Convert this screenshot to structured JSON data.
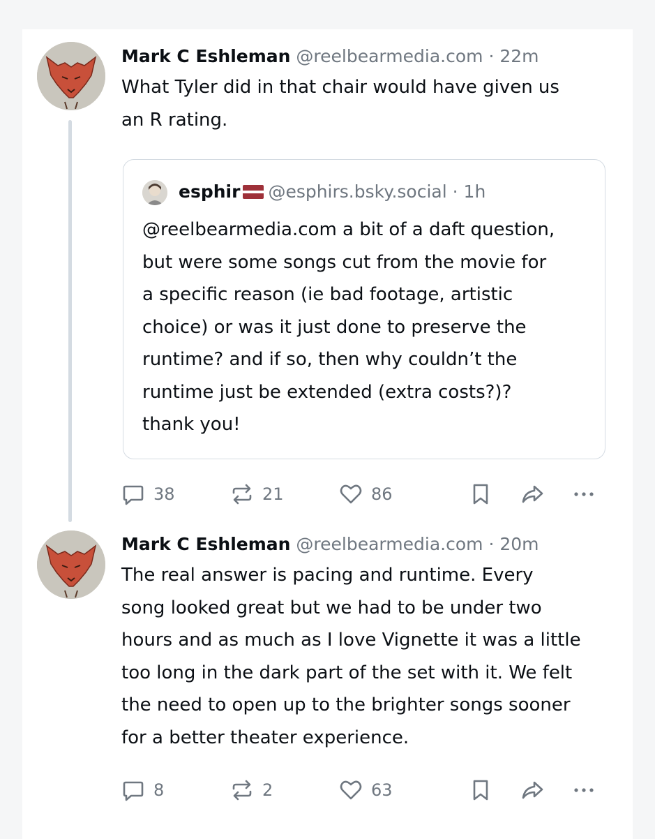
{
  "posts": [
    {
      "author": "Mark C Eshleman",
      "handle": "@reelbearmedia.com",
      "separator": "·",
      "time": "22m",
      "text_lines": [
        "What Tyler did in that chair would have given us",
        "an R rating."
      ],
      "quote": {
        "author": "esphir",
        "flag": "latvia-flag-icon",
        "handle": "@esphirs.bsky.social",
        "separator": "·",
        "time": "1h",
        "text_lines": [
          "@reelbearmedia.com a bit of a daft question,",
          "but were some songs cut from the movie for",
          "a specific reason (ie bad footage, artistic",
          "choice) or was it just done to preserve the",
          "runtime? and if so, then why couldn’t the",
          "runtime just be extended (extra costs?)?",
          "thank you!"
        ]
      },
      "replies": "38",
      "reposts": "21",
      "likes": "86"
    },
    {
      "author": "Mark C Eshleman",
      "handle": "@reelbearmedia.com",
      "separator": "·",
      "time": "20m",
      "text_lines": [
        "The real answer is pacing and runtime. Every",
        "song looked great but we had to be under two",
        "hours and as much as I love Vignette it was a little",
        "too long in the dark part of the set with it. We felt",
        "the need to open up to the brighter songs sooner",
        "for a better theater experience."
      ],
      "replies": "8",
      "reposts": "2",
      "likes": "63"
    }
  ],
  "colors": {
    "text": "#0b0f14",
    "muted": "#6f7780",
    "border": "#d4dbe2",
    "flag_red": "#9e3039"
  },
  "icons": [
    "reply-icon",
    "repost-icon",
    "like-icon",
    "bookmark-icon",
    "share-icon",
    "more-icon"
  ]
}
